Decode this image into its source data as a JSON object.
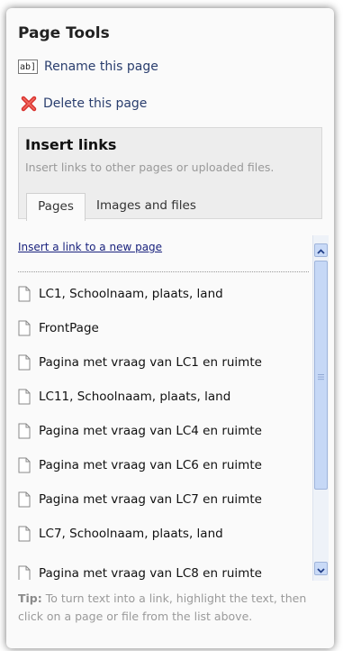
{
  "page_tools": {
    "title": "Page Tools",
    "rename_icon_text": "ab]",
    "rename_label": "Rename this page",
    "delete_label": "Delete this page"
  },
  "insert_links": {
    "title": "Insert links",
    "subtitle": "Insert links to other pages or uploaded files.",
    "tabs": [
      {
        "label": "Pages",
        "active": true
      },
      {
        "label": "Images and files",
        "active": false
      }
    ],
    "new_page_link": "Insert a link to a new page",
    "pages": [
      "LC1, Schoolnaam, plaats, land",
      "FrontPage",
      "Pagina met vraag van LC1 en ruimte",
      "LC11, Schoolnaam, plaats, land",
      "Pagina met vraag van LC4 en ruimte",
      "Pagina met vraag van LC6 en ruimte",
      "Pagina met vraag van LC7 en ruimte",
      "LC7, Schoolnaam, plaats, land",
      "Pagina met vraag van LC8 en ruimte"
    ]
  },
  "tip": {
    "label": "Tip:",
    "text": "To turn text into a link, highlight the text, then click on a page or file from the list above."
  },
  "colors": {
    "link": "#2a3e6e",
    "delete_icon": "#d9302c",
    "scroll_thumb": "#c6d8f6"
  }
}
